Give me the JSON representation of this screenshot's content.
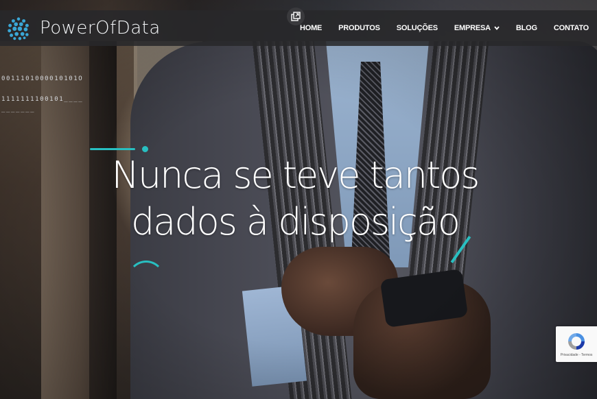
{
  "brand": {
    "name": "PowerOfData",
    "accent_color": "#28bfc1",
    "logo_color": "#3aa7d6"
  },
  "nav": {
    "items": [
      {
        "label": "HOME",
        "has_dropdown": false
      },
      {
        "label": "PRODUTOS",
        "has_dropdown": false
      },
      {
        "label": "SOLUÇÕES",
        "has_dropdown": false
      },
      {
        "label": "EMPRESA",
        "has_dropdown": true
      },
      {
        "label": "BLOG",
        "has_dropdown": false
      },
      {
        "label": "CONTATO",
        "has_dropdown": false
      }
    ],
    "background": "#28282a"
  },
  "hero": {
    "headline_line1": "Nunca se teve tantos",
    "headline_line2": "dados à disposição",
    "binary_line1": "0011101000010101O",
    "binary_line2": "1111111100101____",
    "binary_line3": "_______"
  },
  "icons": {
    "popout": "popout-icon",
    "recaptcha": "recaptcha-icon",
    "dropdown": "chevron-down-icon"
  },
  "recaptcha": {
    "text": "Privacidade - Termos"
  }
}
